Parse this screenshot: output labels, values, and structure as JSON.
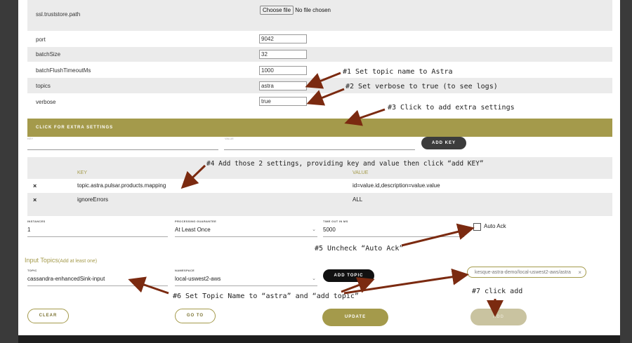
{
  "colors": {
    "accent": "#a49a4b",
    "arrow": "#7b2a10"
  },
  "config_rows": [
    {
      "label": "ssl.truststore.path"
    },
    {
      "label": "port",
      "value": "9042"
    },
    {
      "label": "batchSize",
      "value": "32"
    },
    {
      "label": "batchFlushTimeoutMs",
      "value": "1000"
    },
    {
      "label": "topics",
      "value": "astra"
    },
    {
      "label": "verbose",
      "value": "true"
    }
  ],
  "file_input": {
    "button": "Choose file",
    "status": "No file chosen"
  },
  "extra_settings": {
    "bar_label": "CLICK FOR EXTRA SETTINGS",
    "key_label": "KEY",
    "value_label": "VALUE",
    "add_key_button": "ADD KEY",
    "table_headers": {
      "key": "KEY",
      "value": "VALUE"
    },
    "rows": [
      {
        "key": "topic.astra.pulsar.products.mapping",
        "value": "id=value.id,description=value.value"
      },
      {
        "key": "ignoreErrors",
        "value": "ALL"
      }
    ]
  },
  "remove_icon": "×",
  "fields": {
    "instances": {
      "label": "INSTANCES",
      "value": "1"
    },
    "processing": {
      "label": "PROCESSING GUARANTEE",
      "value": "At Least Once"
    },
    "timeout": {
      "label": "TIME OUT IN MS",
      "value": "5000"
    },
    "auto_ack": {
      "label": "Auto Ack",
      "checked": false
    }
  },
  "input_topics": {
    "title": "Input Topics",
    "hint": "(Add at least one)",
    "topic": {
      "label": "TOPIC",
      "value": "cassandra-enhancedSink-input"
    },
    "namespace": {
      "label": "NAMESPACE",
      "value": "local-uswest2-aws"
    },
    "add_topic_button": "ADD TOPIC",
    "chip": "kesque-astra-demo/local-uswest2-aws/astra",
    "chip_remove": "×"
  },
  "buttons": {
    "clear": "CLEAR",
    "goto": "GO TO",
    "update": "UPDATE",
    "add": "ADD"
  },
  "chevron_icon": "⌄",
  "notes": {
    "n1": "#1 Set topic name to Astra",
    "n2": "#2 Set verbose to true (to see logs)",
    "n3": "#3 Click to add extra settings",
    "n4": "#4 Add those 2 settings, providing key and value then click “add KEY”",
    "n5": "#5 Uncheck “Auto Ack”",
    "n6": "#6 Set Topic Name to “astra” and “add topic”",
    "n7": "#7 click add"
  }
}
